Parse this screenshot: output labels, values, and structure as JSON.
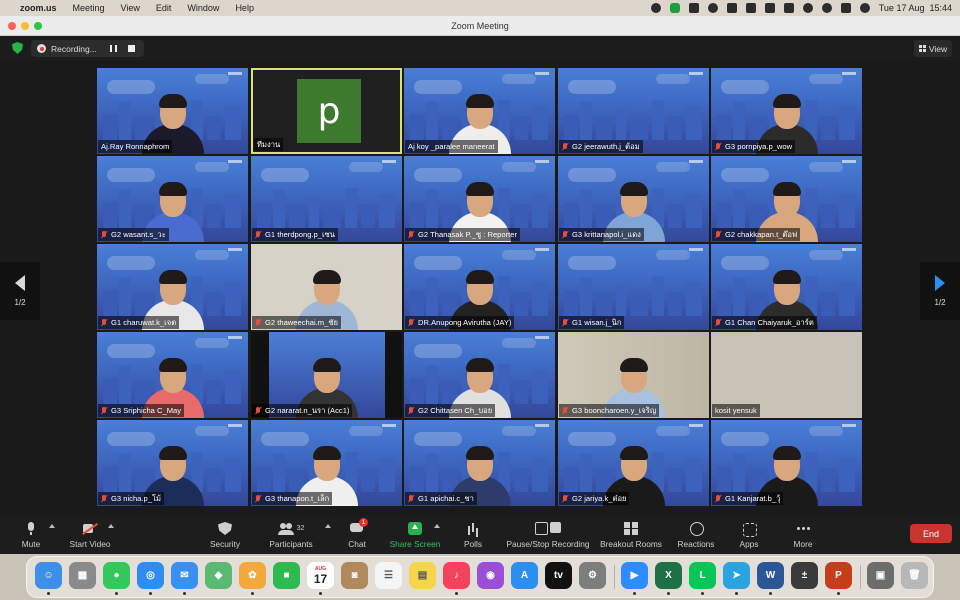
{
  "menubar": {
    "app": "zoom.us",
    "items": [
      "Meeting",
      "View",
      "Edit",
      "Window",
      "Help"
    ],
    "datetime": "Tue 17 Aug  15:44"
  },
  "window": {
    "title": "Zoom Meeting"
  },
  "recording": {
    "label": "Recording..."
  },
  "view_button": {
    "label": "View"
  },
  "page_indicator": {
    "left": "1/2",
    "right": "1/2"
  },
  "participants": [
    {
      "name": "Aj.Ray Ronnaphrom",
      "muted": false,
      "kind": "bg",
      "shirt": "#1a1a2a"
    },
    {
      "name": "ทีมงาน",
      "muted": false,
      "kind": "avatar",
      "initial": "p"
    },
    {
      "name": "Aj koy _paralee maneerat",
      "muted": false,
      "kind": "bg",
      "shirt": "#eeeeee"
    },
    {
      "name": "G2 jeerawuth.j_ต้อม",
      "muted": true,
      "kind": "bg",
      "shirt": ""
    },
    {
      "name": "G3 pornpiya.p_wow",
      "muted": true,
      "kind": "bg",
      "shirt": "#2b2b2b"
    },
    {
      "name": "G2 wasant.s_วะ",
      "muted": true,
      "kind": "bg",
      "shirt": "#4a6bd0"
    },
    {
      "name": "G1 therdpong.p_เซน",
      "muted": true,
      "kind": "bg",
      "shirt": ""
    },
    {
      "name": "G2 Thanasak P._ซู : Reporter",
      "muted": true,
      "kind": "bg",
      "shirt": "#f2f2f2"
    },
    {
      "name": "G3 krittanapol.i_แดง",
      "muted": true,
      "kind": "bg",
      "shirt": "#7fa4d6"
    },
    {
      "name": "G2 chakkapan.t_ต๊อฟ",
      "muted": true,
      "kind": "bg",
      "shirt": "#d9a77e"
    },
    {
      "name": "G1 charuwat.k_เจต",
      "muted": true,
      "kind": "bg",
      "shirt": "#e8e8e8"
    },
    {
      "name": "G2 thaweechai.m_ชัย",
      "muted": true,
      "kind": "real",
      "shirt": "#9fb6d6"
    },
    {
      "name": "DR.Anupong Avirutha (JAY)",
      "muted": true,
      "kind": "bg",
      "shirt": "#222222"
    },
    {
      "name": "G1 wisan.j_นิก",
      "muted": true,
      "kind": "bg",
      "shirt": ""
    },
    {
      "name": "G1 Chan Chaiyaruk_อาร์ต",
      "muted": true,
      "kind": "bg",
      "shirt": "#2c2c2c"
    },
    {
      "name": "G3 Sriphicha C_May",
      "muted": true,
      "kind": "bg",
      "shirt": "#e86a6a"
    },
    {
      "name": "G2 nararat.n_นรา (Acc1)",
      "muted": true,
      "kind": "dark",
      "shirt": "#333333"
    },
    {
      "name": "G2 Chittasen Ch_บอย",
      "muted": true,
      "kind": "bg",
      "shirt": "#e0e0e0"
    },
    {
      "name": "G3 booncharoen.y_เจริญ",
      "muted": true,
      "kind": "office",
      "shirt": "#a9bfe0"
    },
    {
      "name": "kosit yensuk",
      "muted": false,
      "kind": "blank",
      "shirt": ""
    },
    {
      "name": "G3 nicha.p_โม้",
      "muted": true,
      "kind": "bg",
      "shirt": "#1d2d5a"
    },
    {
      "name": "G3 thanapon.t_เล็ก",
      "muted": true,
      "kind": "bg",
      "shirt": "#f0f0f0"
    },
    {
      "name": "G1 apichai.c_ชา",
      "muted": true,
      "kind": "bg",
      "shirt": "#2e3c6c"
    },
    {
      "name": "G2 jariya.k_ต๋อย",
      "muted": true,
      "kind": "bg",
      "shirt": "#1a1a1a"
    },
    {
      "name": "G1 Kanjarat.b_วุ้",
      "muted": true,
      "kind": "bg",
      "shirt": "#1a1a1a"
    }
  ],
  "toolbar": {
    "mute": "Mute",
    "start_video": "Start Video",
    "security": "Security",
    "participants": "Participants",
    "participants_count": "32",
    "chat": "Chat",
    "chat_badge": "1",
    "share_screen": "Share Screen",
    "polls": "Polls",
    "recording": "Pause/Stop Recording",
    "breakout": "Breakout Rooms",
    "reactions": "Reactions",
    "apps": "Apps",
    "more": "More",
    "end": "End"
  },
  "dock": {
    "calendar_month": "AUG",
    "calendar_day": "17",
    "apps": [
      {
        "name": "finder",
        "color": "#3d8fe8",
        "glyph": "☺"
      },
      {
        "name": "launchpad",
        "color": "#8a8a8a",
        "glyph": "▦"
      },
      {
        "name": "messages",
        "color": "#34c759",
        "glyph": "●"
      },
      {
        "name": "safari",
        "color": "#2f8df2",
        "glyph": "◎"
      },
      {
        "name": "mail",
        "color": "#3a8ff0",
        "glyph": "✉"
      },
      {
        "name": "maps",
        "color": "#5bb974",
        "glyph": "◆"
      },
      {
        "name": "photos",
        "color": "#f3a93a",
        "glyph": "✿"
      },
      {
        "name": "facetime",
        "color": "#2dbb4f",
        "glyph": "■"
      },
      {
        "name": "calendar",
        "color": "#ffffff",
        "glyph": ""
      },
      {
        "name": "contacts",
        "color": "#b08a5a",
        "glyph": "◙"
      },
      {
        "name": "reminders",
        "color": "#f5f5f5",
        "glyph": "☰"
      },
      {
        "name": "notes",
        "color": "#f7d54a",
        "glyph": "▤"
      },
      {
        "name": "music",
        "color": "#f2435c",
        "glyph": "♪"
      },
      {
        "name": "podcasts",
        "color": "#9b4fd6",
        "glyph": "◉"
      },
      {
        "name": "app-store",
        "color": "#2b8ef0",
        "glyph": "A"
      },
      {
        "name": "apple-tv",
        "color": "#111111",
        "glyph": "tv"
      },
      {
        "name": "system-preferences",
        "color": "#7d7d7d",
        "glyph": "⚙"
      },
      {
        "name": "zoom",
        "color": "#2d8cff",
        "glyph": "▶"
      },
      {
        "name": "excel",
        "color": "#1e7145",
        "glyph": "X"
      },
      {
        "name": "line",
        "color": "#06c755",
        "glyph": "L"
      },
      {
        "name": "telegram",
        "color": "#2aa3e0",
        "glyph": "➤"
      },
      {
        "name": "word",
        "color": "#2b5797",
        "glyph": "W"
      },
      {
        "name": "calculator",
        "color": "#3a3a3a",
        "glyph": "±"
      },
      {
        "name": "powerpoint",
        "color": "#c43e1c",
        "glyph": "P"
      },
      {
        "name": "downloads-stack",
        "color": "#6c6c6c",
        "glyph": "▣"
      },
      {
        "name": "trash",
        "color": "#b8b8b8",
        "glyph": "🗑"
      }
    ]
  }
}
